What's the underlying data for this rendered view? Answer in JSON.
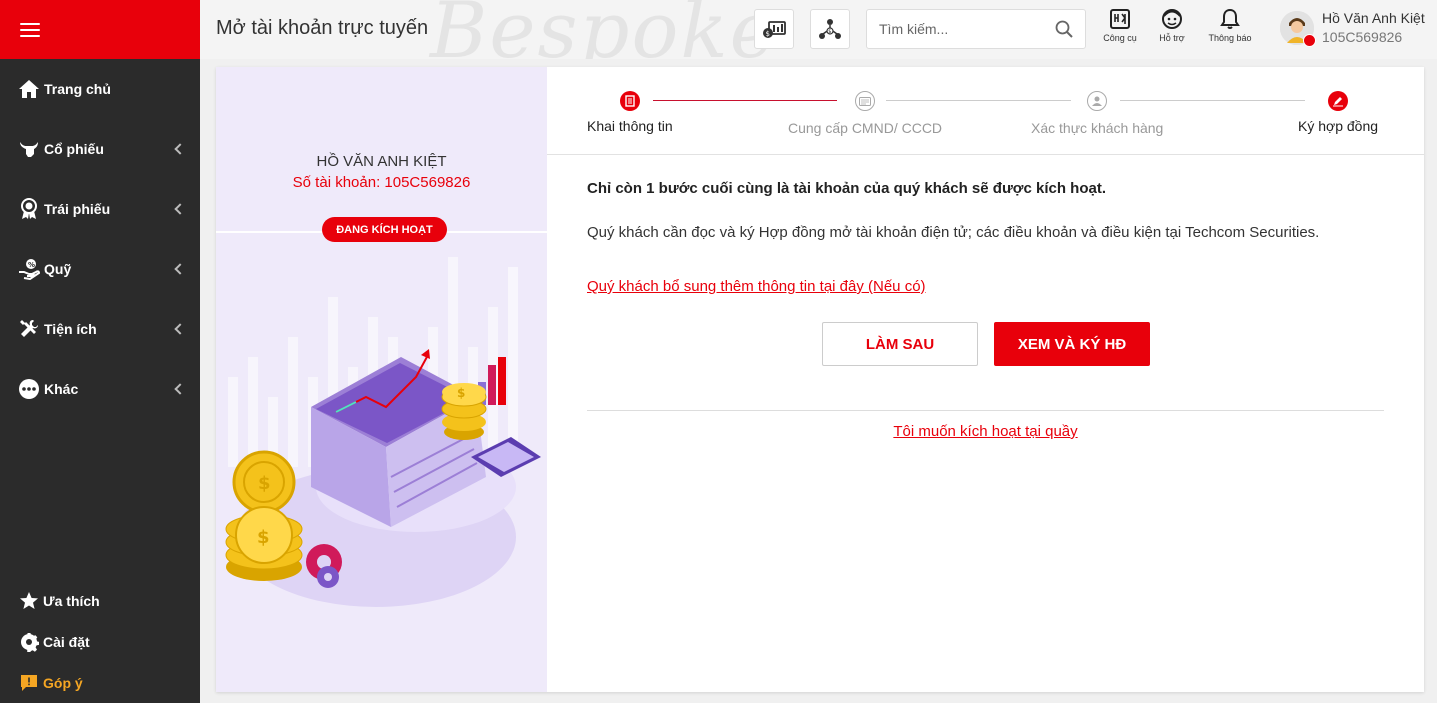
{
  "header": {
    "title": "Mở tài khoản trực tuyến",
    "watermark": "Bespoke",
    "search_placeholder": "Tìm kiếm...",
    "tools": [
      {
        "label": "Công cụ",
        "icon": "tools-icon"
      },
      {
        "label": "Hỗ trợ",
        "icon": "support-icon"
      },
      {
        "label": "Thông báo",
        "icon": "bell-icon"
      }
    ],
    "user": {
      "name": "Hồ Văn Anh Kiệt",
      "id": "105C569826"
    }
  },
  "sidebar": {
    "items": [
      {
        "label": "Trang chủ",
        "icon": "home-icon"
      },
      {
        "label": "Cổ phiếu",
        "icon": "bull-icon"
      },
      {
        "label": "Trái phiếu",
        "icon": "medal-icon"
      },
      {
        "label": "Quỹ",
        "icon": "fund-icon"
      },
      {
        "label": "Tiện ích",
        "icon": "tools-cross-icon"
      },
      {
        "label": "Khác",
        "icon": "more-icon"
      }
    ],
    "bottom": [
      {
        "label": "Ưa thích",
        "icon": "star-icon"
      },
      {
        "label": "Cài đặt",
        "icon": "gear-icon"
      },
      {
        "label": "Góp ý",
        "icon": "feedback-icon"
      }
    ]
  },
  "left_panel": {
    "name": "HỒ VĂN ANH KIỆT",
    "account": "Số tài khoản: 105C569826",
    "status": "ĐANG KÍCH HOẠT"
  },
  "stepper": {
    "steps": [
      {
        "label": "Khai thông tin",
        "state": "done"
      },
      {
        "label": "Cung cấp CMND/ CCCD",
        "state": "inactive"
      },
      {
        "label": "Xác thực khách hàng",
        "state": "inactive"
      },
      {
        "label": "Ký hợp đồng",
        "state": "active"
      }
    ]
  },
  "main": {
    "headline": "Chỉ còn 1 bước cuối cùng là tài khoản của quý khách sẽ được kích hoạt.",
    "message": "Quý khách cần đọc và ký Hợp đồng mở tài khoản điện tử; các điều khoản và điều kiện tại Techcom Securities.",
    "supplement_link": "Quý khách bổ sung thêm thông tin tại đây (Nếu có)",
    "later_button": "LÀM SAU",
    "sign_button": "XEM VÀ KÝ HĐ",
    "counter_link": "Tôi muốn kích hoạt tại quầy"
  },
  "colors": {
    "brand": "#e8000b",
    "sidebar": "#2b2b2b",
    "panel": "#efeafa",
    "feedback": "#f5a623"
  }
}
